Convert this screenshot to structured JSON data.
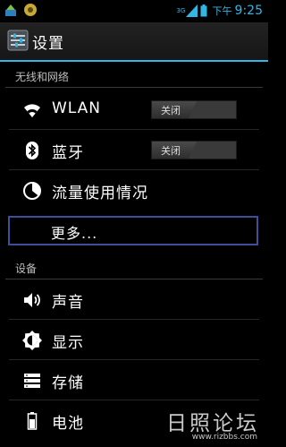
{
  "status_bar": {
    "network": "3G",
    "ampm": "下午",
    "time": "9:25"
  },
  "action_bar": {
    "title": "设置"
  },
  "sections": {
    "wireless": {
      "header": "无线和网络",
      "items": [
        {
          "label": "WLAN",
          "icon": "wifi-icon",
          "toggle": "关闭"
        },
        {
          "label": "蓝牙",
          "icon": "bluetooth-icon",
          "toggle": "关闭"
        },
        {
          "label": "流量使用情况",
          "icon": "data-usage-icon"
        },
        {
          "label": "更多..."
        }
      ]
    },
    "device": {
      "header": "设备",
      "items": [
        {
          "label": "声音",
          "icon": "speaker-icon"
        },
        {
          "label": "显示",
          "icon": "brightness-icon"
        },
        {
          "label": "存储",
          "icon": "storage-icon"
        },
        {
          "label": "电池",
          "icon": "battery-icon"
        }
      ]
    }
  },
  "watermark": {
    "main": "日照论坛",
    "url": "www.rizbbs.com"
  },
  "colors": {
    "accent": "#33b5e5",
    "focus_border": "#3e4f9a",
    "background": "#000000"
  }
}
